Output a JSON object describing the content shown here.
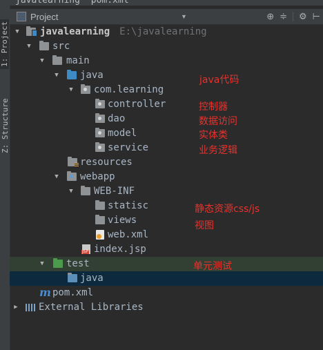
{
  "breadcrumb": {
    "items": [
      "javalearning",
      "pom.xml"
    ]
  },
  "toolstrip": {
    "project_tab": "1: Project",
    "structure_tab": "Z: Structure"
  },
  "header": {
    "title": "Project",
    "tool_icons": [
      "target-icon",
      "collapse-icon",
      "gear-icon",
      "hide-icon"
    ]
  },
  "tree": {
    "root": {
      "name": "javalearning",
      "path": "E:\\javalearning"
    },
    "src": "src",
    "main": "main",
    "java": "java",
    "package": "com.learning",
    "controller": "controller",
    "dao": "dao",
    "model": "model",
    "service": "service",
    "resources": "resources",
    "webapp": "webapp",
    "webinf": "WEB-INF",
    "statisc": "statisc",
    "views": "views",
    "webxml": "web.xml",
    "indexjsp": "index.jsp",
    "test": "test",
    "testjava": "java",
    "pom": "pom.xml",
    "libs": "External Libraries"
  },
  "annotations": {
    "java_code": "java代码",
    "controller": "控制器",
    "data_access": "数据访问",
    "entity": "实体类",
    "business": "业务逻辑",
    "static": "静态资源css/js",
    "views": "视图",
    "unit_test": "单元测试"
  },
  "colors": {
    "annotation": "#e8322d",
    "source_folder": "#3d8ac4",
    "test_folder": "#4c9a4c",
    "selection": "#0d293e"
  }
}
